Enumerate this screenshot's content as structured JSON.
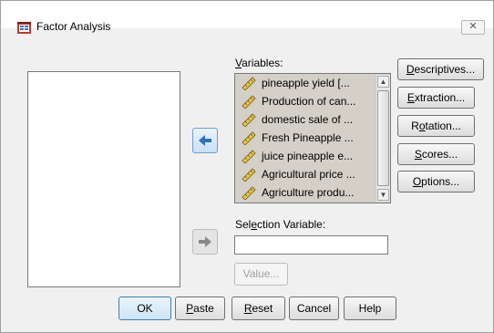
{
  "window": {
    "title": "Factor Analysis",
    "close_glyph": "✕",
    "app_icon": "spss-dialog-icon"
  },
  "variables": {
    "label_prefix": "",
    "label_accel": "V",
    "label_rest": "ariables:",
    "items": [
      "pineapple yield [...",
      "Production of can...",
      "domestic sale of ...",
      "Fresh Pineapple ...",
      "juice pineapple e...",
      "Agricultural price ...",
      "Agriculture produ..."
    ],
    "item_icon": "scale-variable-ruler-icon"
  },
  "selection": {
    "label_pre": "Sel",
    "label_accel": "e",
    "label_post": "ction Variable:",
    "value": "",
    "value_button": "Value..."
  },
  "side_buttons": [
    {
      "pre": "",
      "accel": "D",
      "post": "escriptives..."
    },
    {
      "pre": "",
      "accel": "E",
      "post": "xtraction..."
    },
    {
      "pre": "R",
      "accel": "o",
      "post": "tation..."
    },
    {
      "pre": "",
      "accel": "S",
      "post": "cores..."
    },
    {
      "pre": "",
      "accel": "O",
      "post": "ptions..."
    }
  ],
  "bottom_buttons": {
    "ok": "OK",
    "paste_accel": "P",
    "paste_rest": "aste",
    "reset_accel": "R",
    "reset_rest": "eset",
    "cancel": "Cancel",
    "help": "Help"
  },
  "colors": {
    "arrow_active": "#2f6fc0",
    "arrow_disabled": "#8a8a8a",
    "list_selected_bg": "#d4d0c8"
  }
}
